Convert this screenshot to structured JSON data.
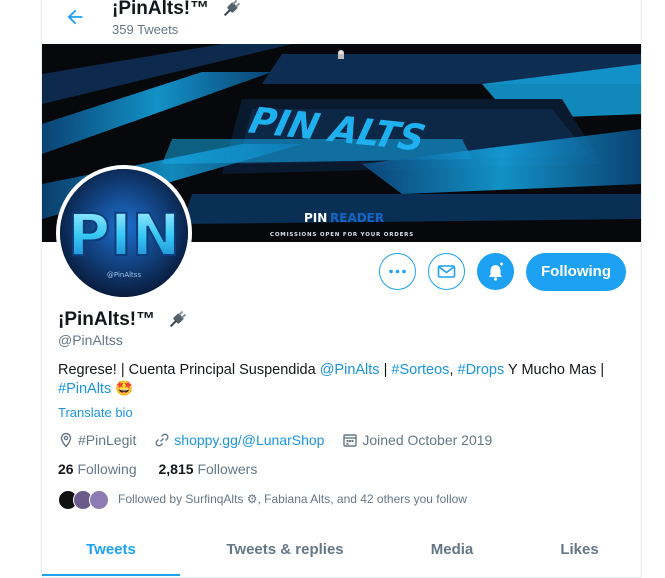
{
  "header": {
    "display_name": "¡PinAlts!™",
    "tweet_count": "359 Tweets"
  },
  "banner": {
    "title": "PIN ALTS",
    "brand_left": "PIN",
    "brand_right": "READER",
    "tagline": "COMISSIONS OPEN FOR YOUR ORDERS"
  },
  "avatar": {
    "text": "PIN",
    "watermark": "@PinAltss"
  },
  "actions": {
    "follow_label": "Following"
  },
  "profile": {
    "name": "¡PinAlts!™",
    "handle": "@PinAltss",
    "bio": {
      "text1": "Regrese! | Cuenta Principal Suspendida ",
      "mention": "@PinAlts",
      "sep1": " | ",
      "tag1": "#Sorteos",
      "sep2": ", ",
      "tag2": "#Drops",
      "text2": " Y Mucho Mas | ",
      "tag3": "#PinAlts",
      "emoji": "🤩"
    },
    "translate": "Translate bio",
    "location": "#PinLegit",
    "website": "shoppy.gg/@LunarShop",
    "joined": "Joined October 2019"
  },
  "stats": {
    "following_count": "26",
    "following_label": "Following",
    "followers_count": "2,815",
    "followers_label": "Followers"
  },
  "followed_by": "Followed by SurfinqAlts ⚙, Fabiana Alts, and 42 others you follow",
  "tabs": [
    "Tweets",
    "Tweets & replies",
    "Media",
    "Likes"
  ],
  "colors": {
    "accent": "#1da1f2",
    "secondary_text": "#657786",
    "banner_cyan": "#14a9e6"
  }
}
